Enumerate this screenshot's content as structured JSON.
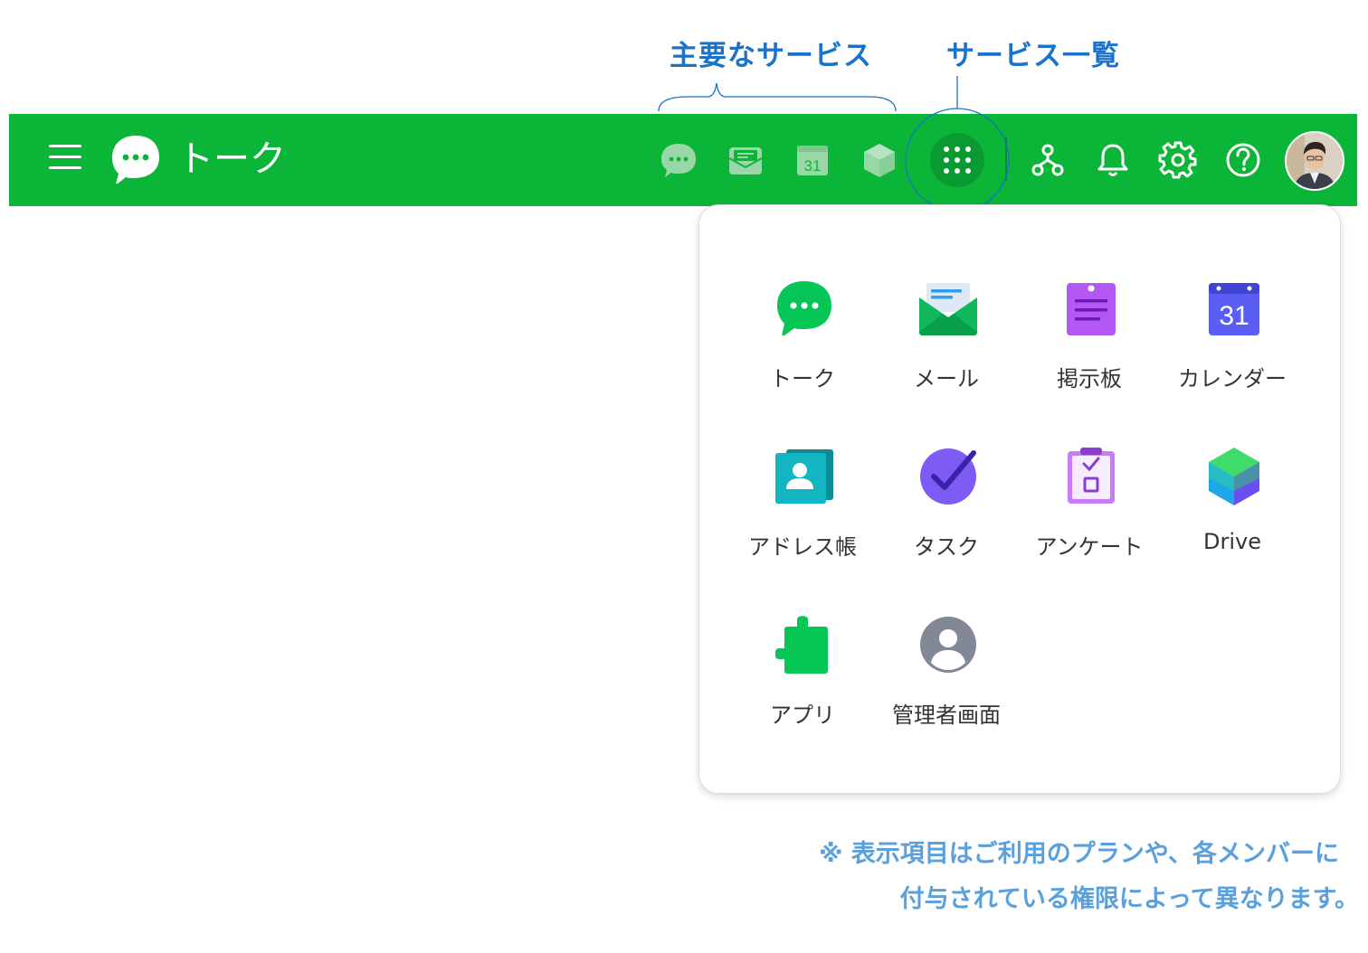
{
  "annotations": {
    "main_services": "主要なサービス",
    "service_list": "サービス一覧",
    "note_line1": "※ 表示項目はご利用のプランや、各メンバーに",
    "note_line2": "付与されている権限によって異なります。"
  },
  "header": {
    "title": "トーク",
    "calendar_icon_day": "31",
    "background_color": "#0bb538",
    "service_icons": [
      "chat-icon",
      "mail-icon",
      "calendar-icon",
      "cube-icon"
    ],
    "right_icons": [
      "grid-icon",
      "org-chart-icon",
      "bell-icon",
      "gear-icon",
      "help-icon",
      "avatar"
    ]
  },
  "service_panel": {
    "items": [
      {
        "label": "トーク",
        "icon": "talk-icon"
      },
      {
        "label": "メール",
        "icon": "mail-icon"
      },
      {
        "label": "掲示板",
        "icon": "board-icon"
      },
      {
        "label": "カレンダー",
        "icon": "calendar-icon",
        "day": "31"
      },
      {
        "label": "アドレス帳",
        "icon": "address-book-icon"
      },
      {
        "label": "タスク",
        "icon": "task-icon"
      },
      {
        "label": "アンケート",
        "icon": "survey-icon"
      },
      {
        "label": "Drive",
        "icon": "drive-icon"
      },
      {
        "label": "アプリ",
        "icon": "app-icon"
      },
      {
        "label": "管理者画面",
        "icon": "admin-icon"
      }
    ]
  },
  "colors": {
    "brand_green": "#0bb538",
    "annotation_blue": "#1a72c9",
    "note_blue": "#5aa0dc"
  }
}
